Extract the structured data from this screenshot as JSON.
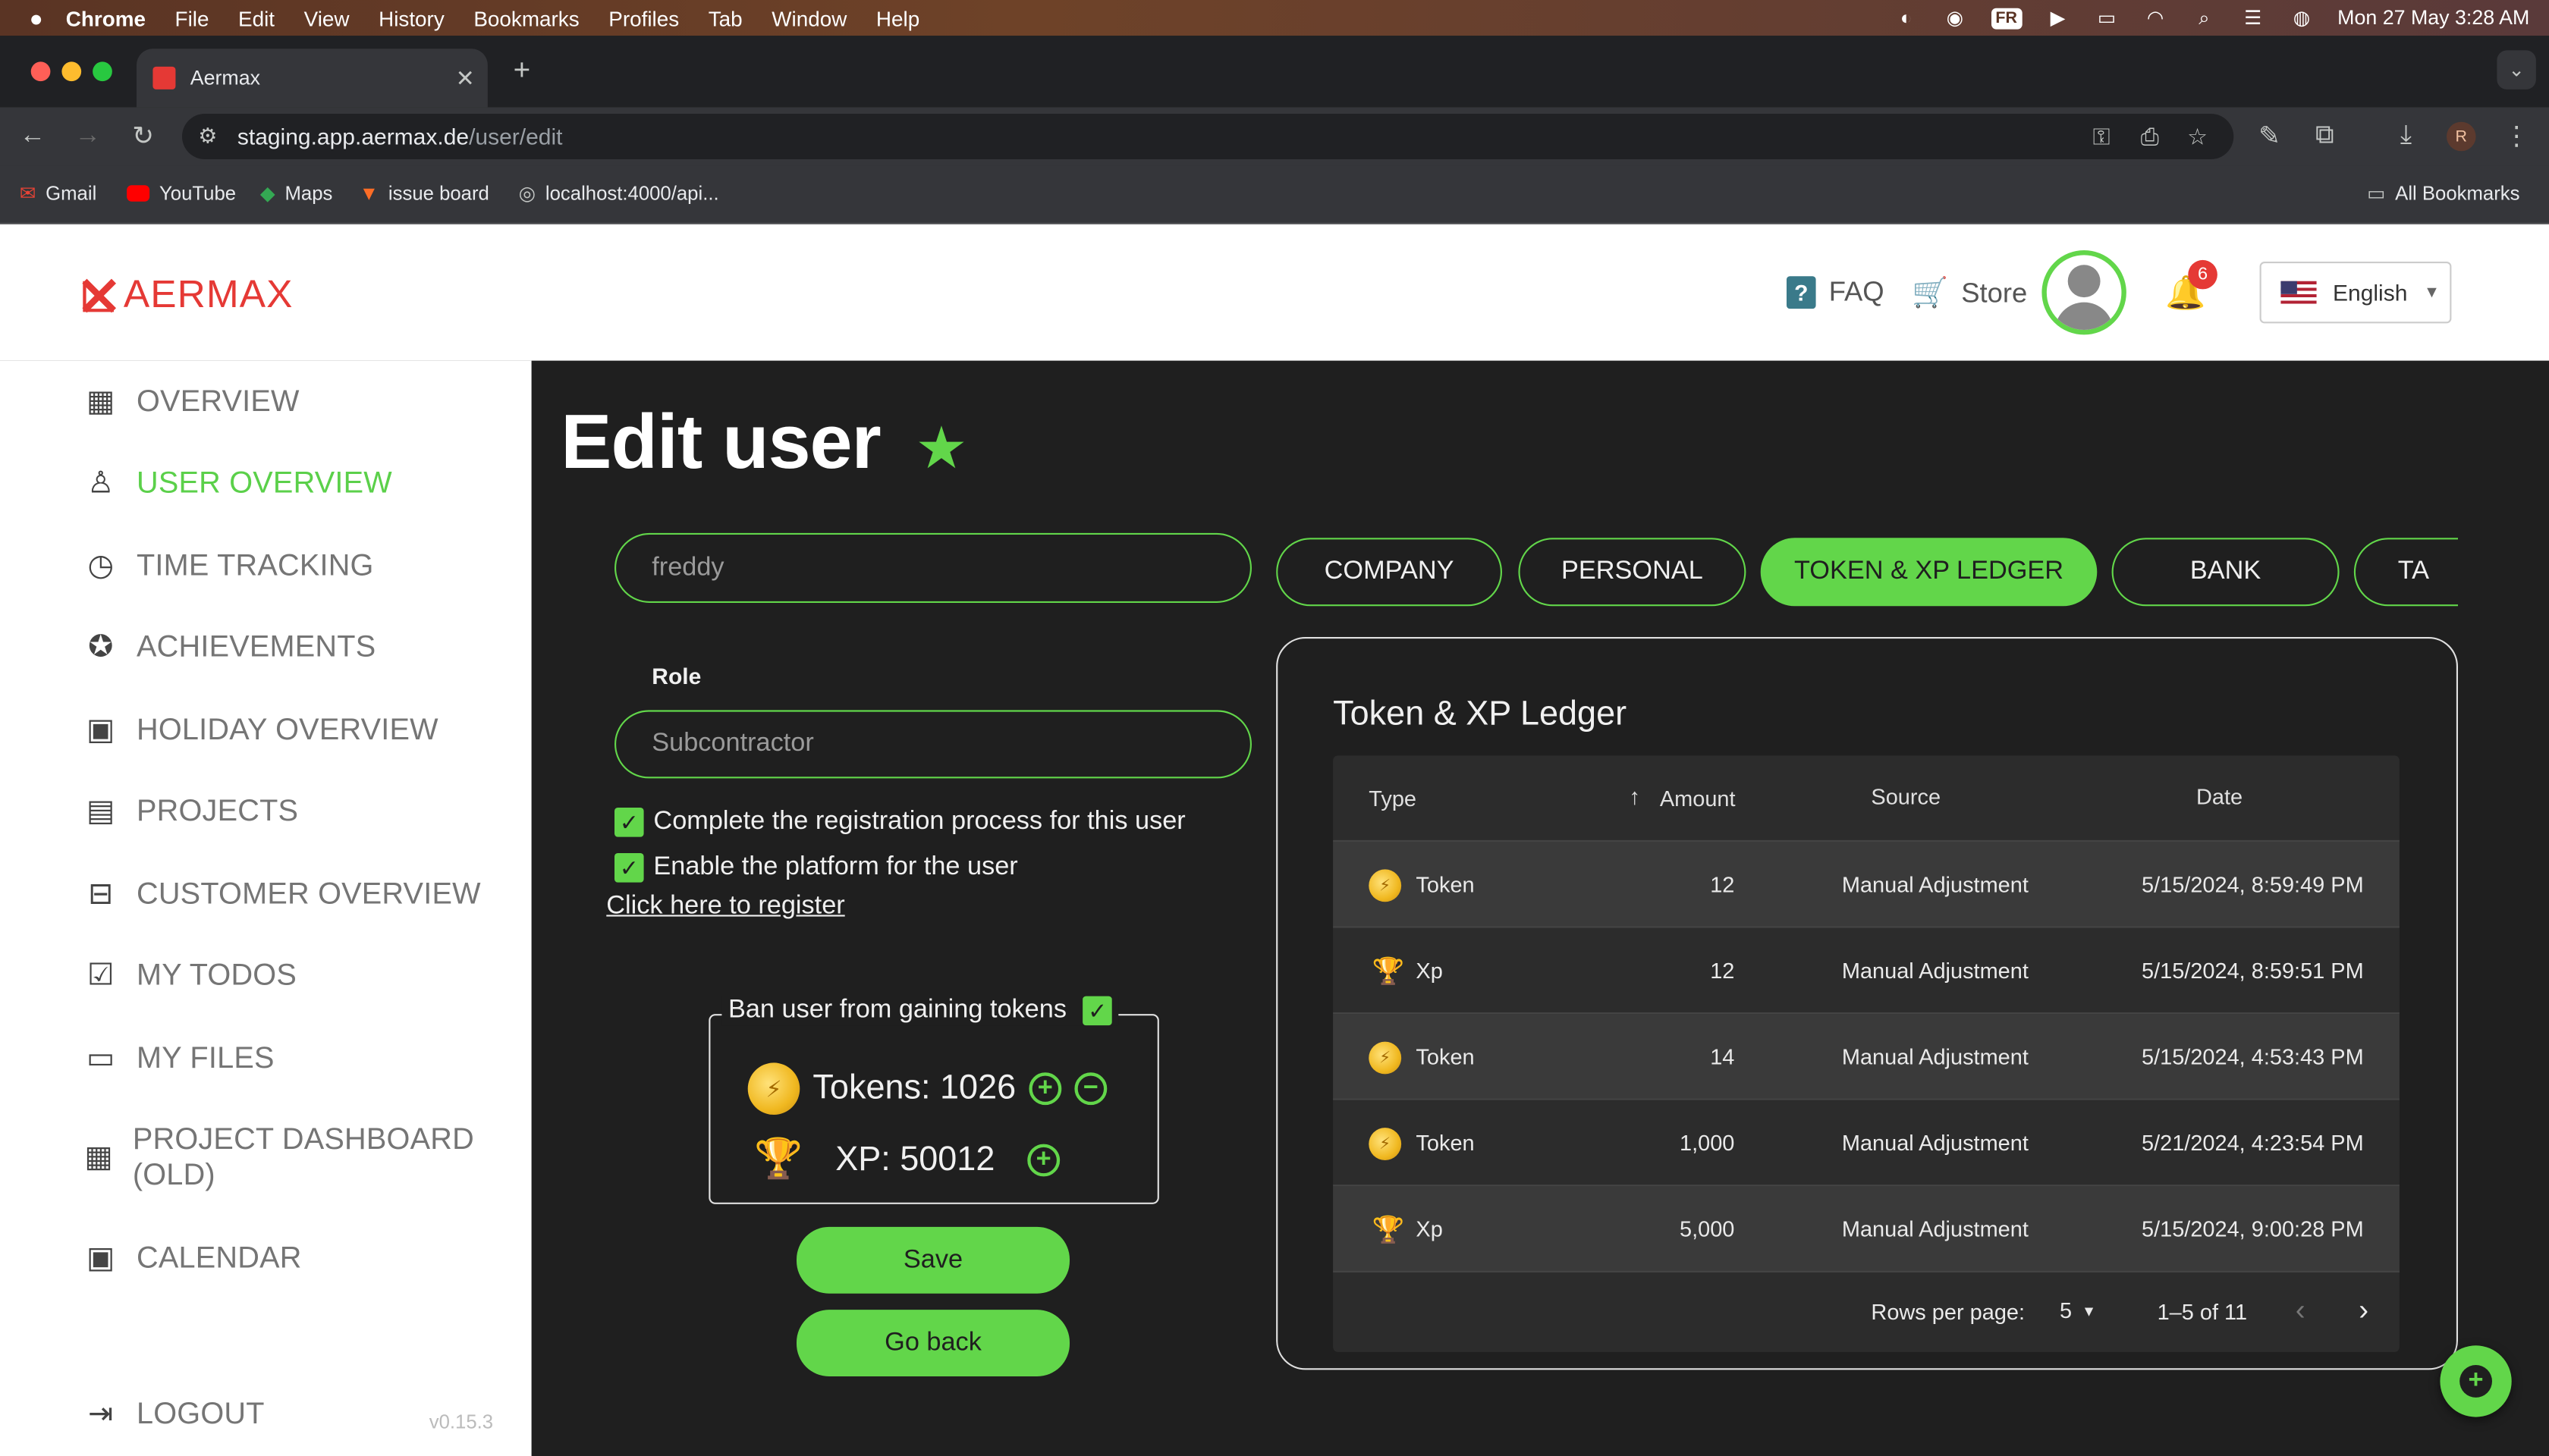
{
  "macos": {
    "menu": [
      "Chrome",
      "File",
      "Edit",
      "View",
      "History",
      "Bookmarks",
      "Profiles",
      "Tab",
      "Window",
      "Help"
    ],
    "clock": "Mon 27 May  3:28 AM",
    "input_source": "FR"
  },
  "browser": {
    "tab_title": "Aermax",
    "url_host": "staging.app.aermax.de",
    "url_path": "/user/edit",
    "bookmarks": [
      "Gmail",
      "YouTube",
      "Maps",
      "issue board",
      "localhost:4000/api..."
    ],
    "all_bookmarks": "All Bookmarks",
    "profile_initial": "R"
  },
  "header": {
    "logo_text": "AERMAX",
    "faq": "FAQ",
    "store": "Store",
    "notifications": "6",
    "language": "English"
  },
  "sidebar": {
    "items": [
      {
        "label": "OVERVIEW"
      },
      {
        "label": "USER OVERVIEW",
        "active": true
      },
      {
        "label": "TIME TRACKING"
      },
      {
        "label": "ACHIEVEMENTS"
      },
      {
        "label": "HOLIDAY OVERVIEW"
      },
      {
        "label": "PROJECTS"
      },
      {
        "label": "CUSTOMER OVERVIEW"
      },
      {
        "label": "MY TODOS"
      },
      {
        "label": "MY FILES"
      },
      {
        "label": "PROJECT DASHBOARD (OLD)"
      },
      {
        "label": "CALENDAR"
      }
    ],
    "logout": "LOGOUT",
    "version": "v0.15.3"
  },
  "page": {
    "title": "Edit user",
    "username": "freddy",
    "role_label": "Role",
    "role_value": "Subcontractor",
    "checkbox_registration": "Complete the registration process for this user",
    "checkbox_platform": "Enable the platform for the user",
    "register_link": "Click here to register",
    "ban_label": "Ban user from gaining tokens",
    "tokens_label": "Tokens: 1026",
    "xp_label": "XP: 50012",
    "save": "Save",
    "go_back": "Go back"
  },
  "tabs": [
    "COMPANY",
    "PERSONAL",
    "TOKEN & XP LEDGER",
    "BANK",
    "TA"
  ],
  "ledger": {
    "title": "Token & XP Ledger",
    "columns": [
      "Type",
      "Amount",
      "Source",
      "Date"
    ],
    "rows": [
      {
        "type": "Token",
        "amount": "12",
        "source": "Manual Adjustment",
        "date": "5/15/2024, 8:59:49 PM"
      },
      {
        "type": "Xp",
        "amount": "12",
        "source": "Manual Adjustment",
        "date": "5/15/2024, 8:59:51 PM"
      },
      {
        "type": "Token",
        "amount": "14",
        "source": "Manual Adjustment",
        "date": "5/15/2024, 4:53:43 PM"
      },
      {
        "type": "Token",
        "amount": "1,000",
        "source": "Manual Adjustment",
        "date": "5/21/2024, 4:23:54 PM"
      },
      {
        "type": "Xp",
        "amount": "5,000",
        "source": "Manual Adjustment",
        "date": "5/15/2024, 9:00:28 PM"
      }
    ],
    "rows_per_page_label": "Rows per page:",
    "rows_per_page": "5",
    "range": "1–5 of 11"
  },
  "colors": {
    "accent": "#62d64a",
    "main_bg": "#1f1f1f",
    "logo": "#e53935"
  }
}
